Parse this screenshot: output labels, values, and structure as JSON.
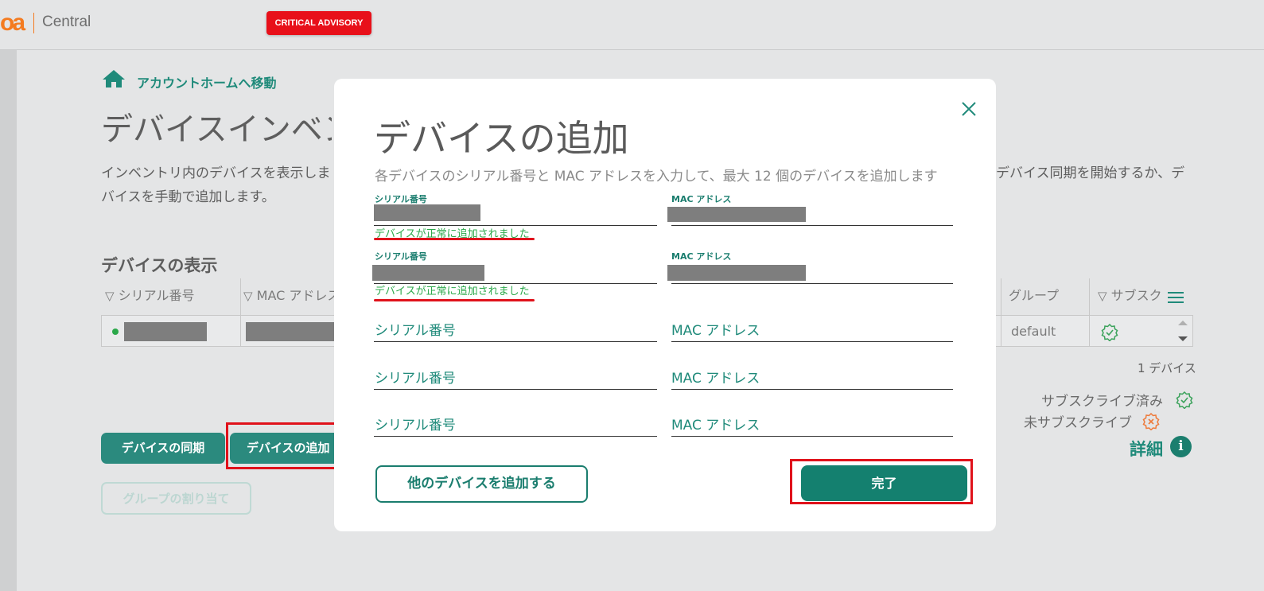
{
  "header": {
    "logo": "oa",
    "brand": "Central",
    "advisory": "CRITICAL ADVISORY"
  },
  "page": {
    "home_link": "アカウントホームへ移動",
    "title": "デバイスインベントリ",
    "desc_left_1": "インベントリ内のデバイスを表示しま",
    "desc_right": "デバイス同期を開始するか、デ",
    "desc_left_2": "バイスを手動で追加します。",
    "section_title": "デバイスの表示",
    "columns": {
      "serial": "シリアル番号",
      "mac": "MAC アドレス",
      "group": "グループ",
      "subscription": "サブスク"
    },
    "row": {
      "group": "default"
    },
    "device_count": "1 デバイス",
    "legend_subscribed": "サブスクライブ済み",
    "legend_unsubscribed": "未サブスクライブ",
    "details": "詳細",
    "btn_sync": "デバイスの同期",
    "btn_add": "デバイスの追加",
    "btn_assign_group": "グループの割り当て"
  },
  "modal": {
    "title": "デバイスの追加",
    "description": "各デバイスのシリアル番号と MAC アドレスを入力して、最大 12 個のデバイスを追加します",
    "serial_label": "シリアル番号",
    "mac_label": "MAC アドレス",
    "success_message": "デバイスが正常に追加されました",
    "serial_placeholder": "シリアル番号",
    "mac_placeholder": "MAC アドレス",
    "btn_add_more": "他のデバイスを追加する",
    "btn_done": "完了"
  }
}
